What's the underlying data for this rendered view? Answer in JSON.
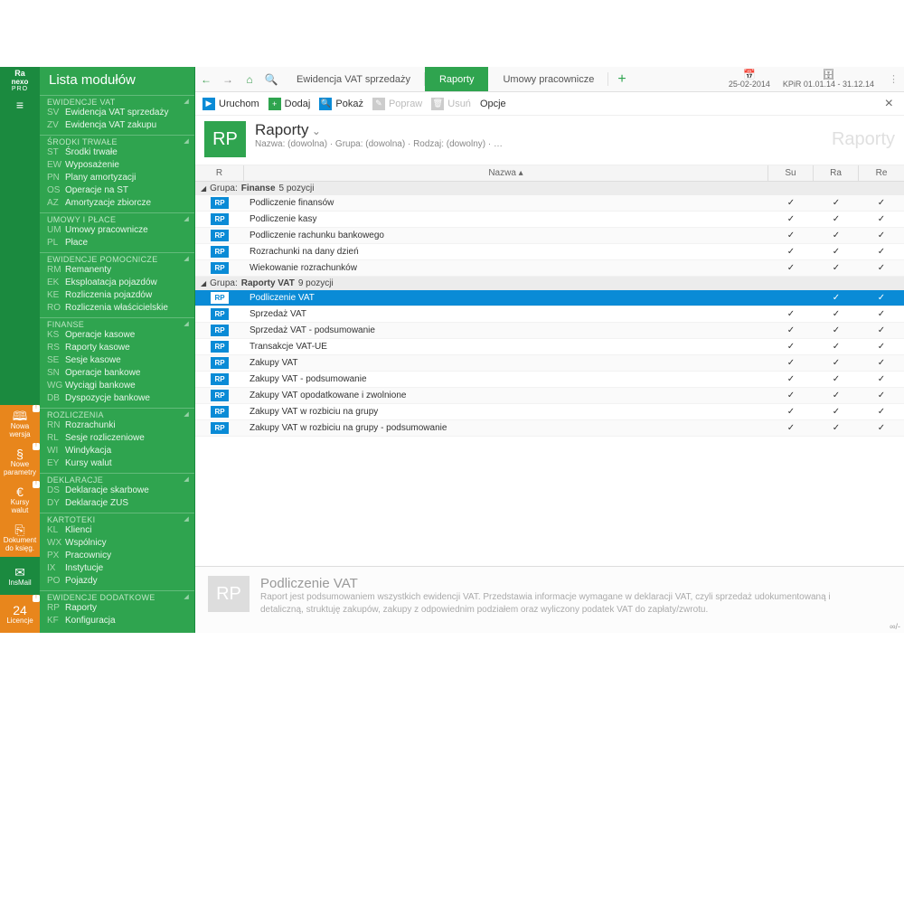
{
  "rail": {
    "logo_top": "Ra",
    "logo_mid": "nexo",
    "logo_sub": "PRO",
    "items": [
      {
        "icon": "🕮",
        "label": "Nowa wersja"
      },
      {
        "icon": "§",
        "label": "Nowe parametry"
      },
      {
        "icon": "€",
        "label": "Kursy walut"
      },
      {
        "icon": "⎘",
        "label": "Dokument do księg."
      },
      {
        "icon": "✉",
        "label": "InsMail"
      },
      {
        "icon": "24",
        "label": "Licencje"
      }
    ]
  },
  "sidebar": {
    "title": "Lista modułów",
    "sections": [
      {
        "h": "EWIDENCJE VAT",
        "items": [
          {
            "c": "SV",
            "t": "Ewidencja VAT sprzedaży"
          },
          {
            "c": "ZV",
            "t": "Ewidencja VAT zakupu"
          }
        ]
      },
      {
        "h": "ŚRODKI TRWAŁE",
        "items": [
          {
            "c": "ST",
            "t": "Środki trwałe"
          },
          {
            "c": "EW",
            "t": "Wyposażenie"
          },
          {
            "c": "PN",
            "t": "Plany amortyzacji"
          },
          {
            "c": "OS",
            "t": "Operacje na ST"
          },
          {
            "c": "AZ",
            "t": "Amortyzacje zbiorcze"
          }
        ]
      },
      {
        "h": "UMOWY I PŁACE",
        "items": [
          {
            "c": "UM",
            "t": "Umowy pracownicze"
          },
          {
            "c": "PL",
            "t": "Płace"
          }
        ]
      },
      {
        "h": "EWIDENCJE POMOCNICZE",
        "items": [
          {
            "c": "RM",
            "t": "Remanenty"
          },
          {
            "c": "EK",
            "t": "Eksploatacja pojazdów"
          },
          {
            "c": "KE",
            "t": "Rozliczenia pojazdów"
          },
          {
            "c": "RO",
            "t": "Rozliczenia właścicielskie"
          }
        ]
      },
      {
        "h": "FINANSE",
        "items": [
          {
            "c": "KS",
            "t": "Operacje kasowe"
          },
          {
            "c": "RS",
            "t": "Raporty kasowe"
          },
          {
            "c": "SE",
            "t": "Sesje kasowe"
          },
          {
            "c": "SN",
            "t": "Operacje bankowe"
          },
          {
            "c": "WG",
            "t": "Wyciągi bankowe"
          },
          {
            "c": "DB",
            "t": "Dyspozycje bankowe"
          }
        ]
      },
      {
        "h": "ROZLICZENIA",
        "items": [
          {
            "c": "RN",
            "t": "Rozrachunki"
          },
          {
            "c": "RL",
            "t": "Sesje rozliczeniowe"
          },
          {
            "c": "WI",
            "t": "Windykacja"
          },
          {
            "c": "EY",
            "t": "Kursy walut"
          }
        ]
      },
      {
        "h": "DEKLARACJE",
        "items": [
          {
            "c": "DS",
            "t": "Deklaracje skarbowe"
          },
          {
            "c": "DY",
            "t": "Deklaracje ZUS"
          }
        ]
      },
      {
        "h": "KARTOTEKI",
        "items": [
          {
            "c": "KL",
            "t": "Klienci"
          },
          {
            "c": "WX",
            "t": "Wspólnicy"
          },
          {
            "c": "PX",
            "t": "Pracownicy"
          },
          {
            "c": "IX",
            "t": "Instytucje"
          },
          {
            "c": "PO",
            "t": "Pojazdy"
          }
        ]
      },
      {
        "h": "EWIDENCJE DODATKOWE",
        "items": [
          {
            "c": "RP",
            "t": "Raporty"
          },
          {
            "c": "KF",
            "t": "Konfiguracja"
          }
        ]
      }
    ]
  },
  "tabs": {
    "list": [
      {
        "l": "Ewidencja VAT sprzedaży"
      },
      {
        "l": "Raporty",
        "active": true
      },
      {
        "l": "Umowy pracownicze"
      }
    ],
    "date1_ic": "📅",
    "date1": "25-02-2014",
    "date2_ic": "🗄",
    "date2": "KPiR  01.01.14 - 31.12.14"
  },
  "toolbar": {
    "run": "Uruchom",
    "add": "Dodaj",
    "show": "Pokaż",
    "edit": "Popraw",
    "del": "Usuń",
    "opt": "Opcje"
  },
  "header": {
    "badge": "RP",
    "title": "Raporty",
    "sub": "Nazwa: (dowolna) · Grupa: (dowolna) · Rodzaj: (dowolny) · …",
    "ghost": "Raporty"
  },
  "cols": {
    "c1": "R",
    "c2": "Nazwa ▴",
    "c3": "Su",
    "c4": "Ra",
    "c5": "Re"
  },
  "groups": [
    {
      "label": "Grupa:",
      "name": "Finanse",
      "count": "5 pozycji",
      "rows": [
        {
          "n": "Podliczenie finansów",
          "su": "✓",
          "ra": "✓",
          "re": "✓"
        },
        {
          "n": "Podliczenie kasy",
          "su": "✓",
          "ra": "✓",
          "re": "✓"
        },
        {
          "n": "Podliczenie rachunku bankowego",
          "su": "✓",
          "ra": "✓",
          "re": "✓"
        },
        {
          "n": "Rozrachunki na dany dzień",
          "su": "✓",
          "ra": "✓",
          "re": "✓"
        },
        {
          "n": "Wiekowanie rozrachunków",
          "su": "✓",
          "ra": "✓",
          "re": "✓"
        }
      ]
    },
    {
      "label": "Grupa:",
      "name": "Raporty VAT",
      "count": "9 pozycji",
      "rows": [
        {
          "n": "Podliczenie VAT",
          "su": "",
          "ra": "✓",
          "re": "✓",
          "sel": true
        },
        {
          "n": "Sprzedaż VAT",
          "su": "✓",
          "ra": "✓",
          "re": "✓"
        },
        {
          "n": "Sprzedaż VAT - podsumowanie",
          "su": "✓",
          "ra": "✓",
          "re": "✓"
        },
        {
          "n": "Transakcje VAT-UE",
          "su": "✓",
          "ra": "✓",
          "re": "✓"
        },
        {
          "n": "Zakupy VAT",
          "su": "✓",
          "ra": "✓",
          "re": "✓"
        },
        {
          "n": "Zakupy VAT - podsumowanie",
          "su": "✓",
          "ra": "✓",
          "re": "✓"
        },
        {
          "n": "Zakupy VAT opodatkowane i zwolnione",
          "su": "✓",
          "ra": "✓",
          "re": "✓"
        },
        {
          "n": "Zakupy VAT w rozbiciu na grupy",
          "su": "✓",
          "ra": "✓",
          "re": "✓"
        },
        {
          "n": "Zakupy VAT w rozbiciu na grupy - podsumowanie",
          "su": "✓",
          "ra": "✓",
          "re": "✓"
        }
      ]
    }
  ],
  "detail": {
    "badge": "RP",
    "title": "Podliczenie VAT",
    "desc": "Raport jest podsumowaniem wszystkich ewidencji VAT. Przedstawia informacje wymagane w deklaracji VAT, czyli sprzedaż udokumentowaną i detaliczną, struktuję zakupów, zakupy z odpowiednim podziałem oraz wyliczony podatek VAT do zapłaty/zwrotu."
  },
  "corner": "∞/-"
}
